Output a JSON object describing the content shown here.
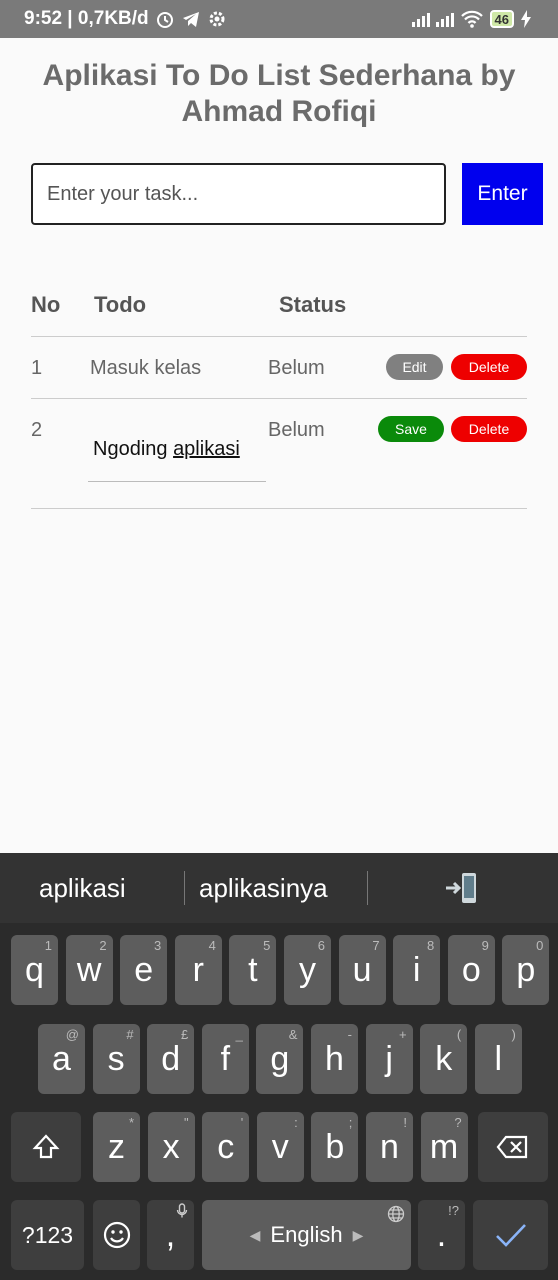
{
  "status_bar": {
    "time_info": "9:52 | 0,7KB/d",
    "battery": "46"
  },
  "app": {
    "title": "Aplikasi To Do List Sederhana by Ahmad Rofiqi",
    "input_placeholder": "Enter your task...",
    "enter_label": "Enter",
    "headers": {
      "no": "No",
      "todo": "Todo",
      "status": "Status"
    },
    "rows": [
      {
        "no": "1",
        "todo": "Masuk kelas",
        "status": "Belum",
        "action": "Edit",
        "delete": "Delete"
      },
      {
        "no": "2",
        "todo_prefix": "Ngoding ",
        "todo_underlined": "aplikasi",
        "status": "Belum",
        "action": "Save",
        "delete": "Delete"
      }
    ]
  },
  "keyboard": {
    "suggestions": [
      "aplikasi",
      "aplikasinya"
    ],
    "row1": [
      {
        "k": "q",
        "h": "1"
      },
      {
        "k": "w",
        "h": "2"
      },
      {
        "k": "e",
        "h": "3"
      },
      {
        "k": "r",
        "h": "4"
      },
      {
        "k": "t",
        "h": "5"
      },
      {
        "k": "y",
        "h": "6"
      },
      {
        "k": "u",
        "h": "7"
      },
      {
        "k": "i",
        "h": "8"
      },
      {
        "k": "o",
        "h": "9"
      },
      {
        "k": "p",
        "h": "0"
      }
    ],
    "row2": [
      {
        "k": "a",
        "h": "@"
      },
      {
        "k": "s",
        "h": "#"
      },
      {
        "k": "d",
        "h": "£"
      },
      {
        "k": "f",
        "h": "_"
      },
      {
        "k": "g",
        "h": "&"
      },
      {
        "k": "h",
        "h": "-"
      },
      {
        "k": "j",
        "h": "+"
      },
      {
        "k": "k",
        "h": "("
      },
      {
        "k": "l",
        "h": ")"
      }
    ],
    "row3": [
      {
        "k": "z",
        "h": "*"
      },
      {
        "k": "x",
        "h": "\""
      },
      {
        "k": "c",
        "h": "'"
      },
      {
        "k": "v",
        "h": ":"
      },
      {
        "k": "b",
        "h": ";"
      },
      {
        "k": "n",
        "h": "!"
      },
      {
        "k": "m",
        "h": "?"
      }
    ],
    "symbols_key": "?123",
    "comma_key": ",",
    "space_label": "English",
    "period_key": ".",
    "period_hint": "!?"
  }
}
